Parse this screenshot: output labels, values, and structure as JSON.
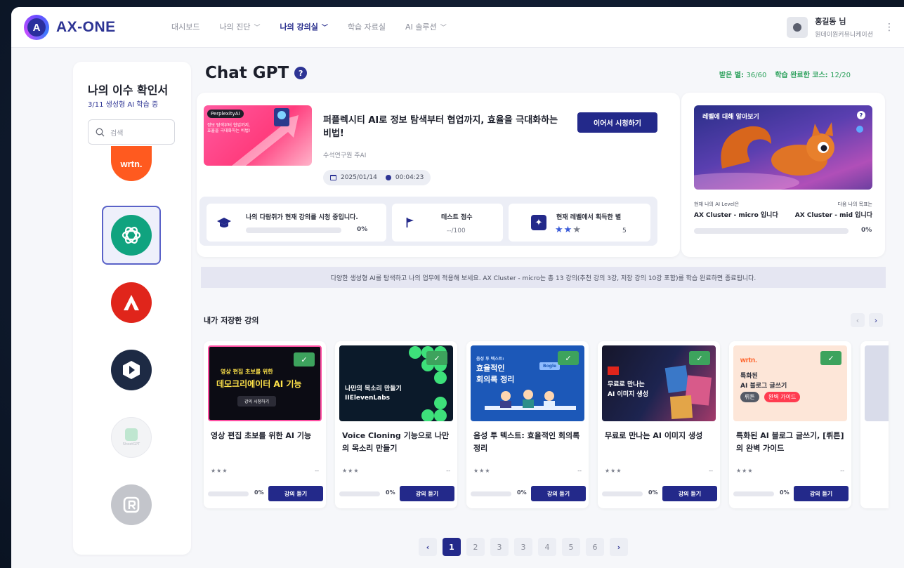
{
  "header": {
    "logo_mark": "A",
    "logo_text": "AX-ONE",
    "nav": [
      {
        "label": "대시보드",
        "dropdown": false,
        "active": false
      },
      {
        "label": "나의 진단",
        "dropdown": true,
        "active": false
      },
      {
        "label": "나의 강의실",
        "dropdown": true,
        "active": true
      },
      {
        "label": "학습 자료실",
        "dropdown": false,
        "active": false
      },
      {
        "label": "AI 솔루션",
        "dropdown": true,
        "active": false
      }
    ],
    "user_name": "홍길동 님",
    "user_org": "원데이원커뮤니케이션"
  },
  "sidebar": {
    "title": "나의 이수 확인서",
    "subtitle": "3/11 생성형 AI 학습 중",
    "search_placeholder": "검색",
    "apps": [
      {
        "name": "wrtn",
        "label": "wrtn.",
        "color": "#ff5a1f"
      },
      {
        "name": "chatgpt",
        "label": "",
        "color": "#10a37f",
        "selected": true
      },
      {
        "name": "adobe",
        "label": "",
        "color": "#e0251b"
      },
      {
        "name": "pictory",
        "label": "",
        "color": "#1d2a44"
      },
      {
        "name": "sheetgpt",
        "label": "SheetGPT",
        "color": "#cfd2d8"
      },
      {
        "name": "replit",
        "label": "",
        "color": "#bdbfc6"
      }
    ]
  },
  "main": {
    "title": "Chat GPT",
    "help": "?",
    "stats": {
      "stars_label": "받은 별:",
      "stars_value": "36/60",
      "completed_label": "학습 완료한 코스:",
      "completed_value": "12/20"
    }
  },
  "current_course": {
    "thumb_tag": "PerplexityAI",
    "thumb_line1": "정보 탐색부터 협업까지,",
    "thumb_line2": "효율을 극대화하는 비법!",
    "title": "퍼플렉시티 AI로 정보 탐색부터 협업까지, 효율을 극대화하는 비법!",
    "author": "수석연구원 주AI",
    "date": "2025/01/14",
    "duration": "00:04:23",
    "resume_label": "이어서 시청하기",
    "metrics": {
      "progress_label": "나의 다람쥐가 현재 강의를 시청 중입니다.",
      "progress": 0,
      "progress_text": "0%",
      "test_label": "테스트 점수",
      "test_value": "--/100",
      "stars_label": "현재 레벨에서 획득한 별",
      "stars_filled": 2,
      "stars_total": 3,
      "stars_count": "5"
    }
  },
  "level": {
    "image_label": "레벨에 대해 알아보기",
    "help": "?",
    "current_caption": "현재 나의 AI Level은",
    "current_value": "AX Cluster - micro 입니다",
    "next_caption": "다음 나의 목표는",
    "next_value": "AX Cluster - mid 입니다",
    "progress": 0,
    "progress_text": "0%"
  },
  "notice": "다양한 생성형 AI를 탐색하고 나의 업무에 적용해 보세요. AX Cluster - micro는 총 13 강의(추천 강의 3강, 저장 강의 10강 포함)를 학습 완료하면 종료됩니다.",
  "saved": {
    "title": "내가 저장한 강의",
    "prev": "‹",
    "next": "›",
    "courses": [
      {
        "title": "영상 편집 초보를 위한 AI 기능",
        "thumb_line1": "영상 편집 초보를 위한",
        "thumb_line2": "데모크리에이터 AI 기능",
        "thumb_button": "강의 시청하기",
        "progress_text": "0%",
        "button": "강의 듣기",
        "stars": "★★★",
        "dash": "--"
      },
      {
        "title": "Voice Cloning 기능으로 나만의 목소리 만들기",
        "thumb_line1": "나만의 목소리 만들기",
        "thumb_line2": "IIElevenLabs",
        "progress_text": "0%",
        "button": "강의 듣기",
        "stars": "★★★",
        "dash": "--"
      },
      {
        "title": "음성 투 텍스트: 효율적인 회의록 정리",
        "thumb_line0": "음성 투 텍스트:",
        "thumb_line1": "효율적인",
        "thumb_line2": "회의록 정리",
        "thumb_tag": "Bogle",
        "progress_text": "0%",
        "button": "강의 듣기",
        "stars": "★★★",
        "dash": "--"
      },
      {
        "title": "무료로 만나는 AI 이미지 생성",
        "thumb_line1": "무료로 만나는",
        "thumb_line2": "AI 이미지 생성",
        "progress_text": "0%",
        "button": "강의 듣기",
        "stars": "★★★",
        "dash": "--"
      },
      {
        "title": "특화된 AI 블로그 글쓰기, [뤼튼]의 완벽 가이드",
        "thumb_brand": "wrtn.",
        "thumb_line1": "특화된",
        "thumb_line2": "AI 블로그 글쓰기",
        "thumb_chip1": "뤼튼",
        "thumb_chip2": "완벽 가이드",
        "progress_text": "0%",
        "button": "강의 듣기",
        "stars": "★★★",
        "dash": "--"
      }
    ]
  },
  "pagination": {
    "prev": "‹",
    "next": "›",
    "pages": [
      "1",
      "2",
      "3",
      "3",
      "4",
      "5",
      "6"
    ],
    "active_index": 0
  }
}
